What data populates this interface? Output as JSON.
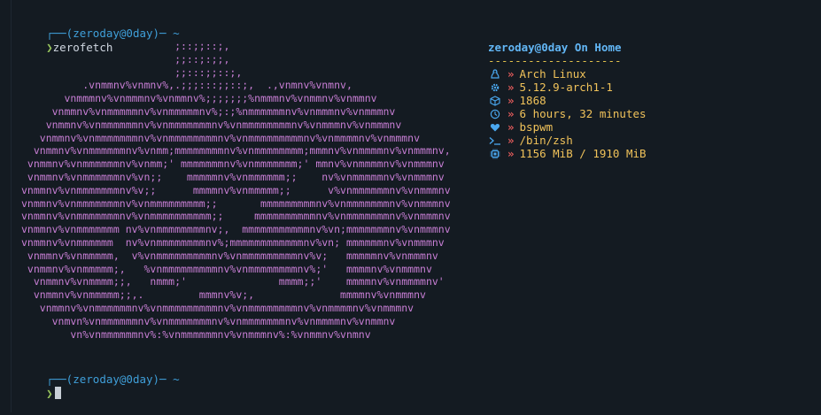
{
  "prompts": [
    {
      "line1": "┌──(zeroday@0day)─ ~",
      "arrow": "❯",
      "command": "zerofetch"
    },
    {
      "line1": "┌──(zeroday@0day)─ ~",
      "arrow": "❯",
      "command": ""
    }
  ],
  "ascii_art": [
    "                         ;::;;::;,",
    "                         ;;::;:;;,",
    "                         ;;:::;;::;,",
    "          .vnmmnv%vnmnv%,.;;;:::;;::;,  .,vnmnv%vnmnv,",
    "       vnmmmnv%vnmmmnv%vnmmnv%;;;;;;;%nmmmnv%vnmmnv%vnmmnv",
    "     vnmmnv%vnmmmmmnv%vnmmmmmnv%;:;%nmmmmmmnv%vnmmmnv%vnmmmnv",
    "    vnmmnv%vnmmmmmmnv%vnmmmmmmmnv%vnmmmmmmmmnv%vnmmmnv%vnmmmnv",
    "   vnmmnv%vnmmmmmmmnv%vnmmmmmmmmnv%vnmmmmmmmmmnv%vnmmmmnv%vnmmmnv",
    "  vnmmnv%vnmmmmmmnv%vnmm;mmmmmmmmnv%vnmmmmmmmm;mmmnv%vnmmmmnv%vnmmmnv,",
    " vnmmnv%vnmmmmmmnv%vnmm;' mmmmmmmnv%vnmmmmmmm;' mmnv%vnmmmmnv%vnmmmnv",
    " vnmmnv%vnmmmmmmnv%vn;;    mmmmmnv%vnmmmmmm;;    nv%vnmmmmmnv%vnmmmnv",
    "vnmmnv%vnmmmmmmmnv%v;;      mmmmnv%vnmmmmm;;      v%vnmmmmmmnv%vnmmmnv",
    "vnmmnv%vnmmmmmmmnv%vnmmmmmmmmm;;       mmmmmmmmmnv%vnmmmmmmmnv%vnmmmnv",
    "vnmmnv%vnmmmmmmmnv%vnmmmmmmmmmm;;     mmmmmmmmmmnv%vnmmmmmmmnv%vnmmmnv",
    "vnmmnv%vnmmmmmmm nv%vnmmmmmmmmnv;,  mmmmmmmmmmmnv%vn;mmmmmmmnv%vnmmmnv",
    "vnmmnv%vnmmmmmm  nv%vnmmmmmmmmnv%;mmmmmmmmmmmmnv%vn; mmmmmmnv%vnmmmnv",
    " vnmmnv%vnmmmmm,  v%vnmmmmmmmmmnv%vnmmmmmmmmmnv%v;   mmmmmnv%vnmmmnv",
    " vnmmnv%vnmmmmm;,   %vnmmmmmmmmmnv%vnmmmmmmmmnv%;'   mmmmnv%vnmmmnv",
    "  vnmmnv%vnmmmm;;,   nmmm;'               mmmm;;'    mmmmnv%vnmmmmnv'",
    "  vnmmnv%vnmmmmm;;,.         mmmnv%v;,              mmmmnv%vnmmmnv",
    "   vnmmnv%vnmmmmmmnv%vnmmmmmmmmmnv%vnmmmmmmmmnv%vnmmmmnv%vnmmmnv",
    "     vnmvn%vnmmmmmmnv%vnmmmmmmmnv%vnmmmmmmmnv%vnmmmmnv%vnmmnv",
    "        vn%vnmmmmmmnv%:%vnmmmmmmnv%vnmmmnv%:%vnmmnv%vnmnv"
  ],
  "info": {
    "user": "zeroday@0day",
    "host_suffix": " On Home",
    "separator": "--------------------",
    "rows": [
      {
        "icon": "linux-icon",
        "value": "Arch Linux"
      },
      {
        "icon": "gear-icon",
        "value": "5.12.9-arch1-1"
      },
      {
        "icon": "package-icon",
        "value": "1868"
      },
      {
        "icon": "clock-icon",
        "value": "6 hours, 32 minutes"
      },
      {
        "icon": "heart-icon",
        "value": "bspwm"
      },
      {
        "icon": "terminal-icon",
        "value": "/bin/zsh"
      },
      {
        "icon": "chip-icon",
        "value": "1156 MiB / 1910 MiB"
      }
    ],
    "chevron": "»"
  },
  "colors": {
    "background": "#141b22",
    "art": "#c97fd6",
    "info_title": "#62b6f5",
    "separator": "#e2c14c",
    "values": "#f0c25a",
    "chevron": "#e05a5a",
    "icons": "#4aa8f0",
    "prompt_arrow": "#97c45c",
    "prompt_corner": "#3f9fd9"
  }
}
